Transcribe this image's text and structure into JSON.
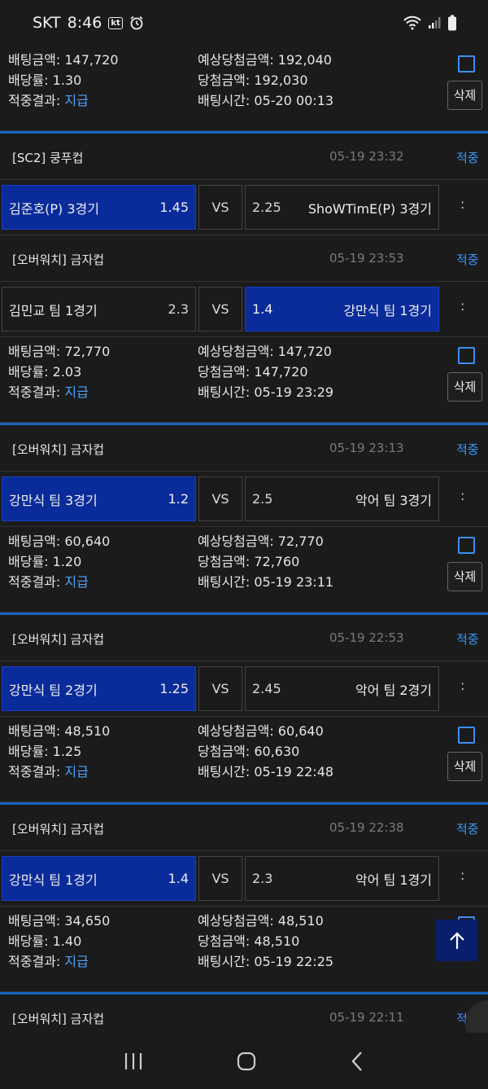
{
  "status_bar": {
    "carrier": "SKT",
    "time": "8:46",
    "kt_badge": "kt"
  },
  "labels": {
    "bet_amount": "배팅금액: ",
    "odds": "배당률: ",
    "result": "적중결과: ",
    "expected_win": "예상당첨금액: ",
    "win_amount": "당첨금액: ",
    "bet_time": "배팅시간: ",
    "delete": "삭제",
    "vs": "VS",
    "more": ":"
  },
  "top_bet": {
    "bet_amount": "147,720",
    "odds": "1.30",
    "result": "지급",
    "expected_win": "192,040",
    "win_amount": "192,030",
    "bet_time": "05-20 00:13"
  },
  "entries": [
    {
      "title": "[SC2] 쿵푸컵",
      "time": "05-19 23:32",
      "status": "적중",
      "home": "김준호(P) 3경기",
      "home_odd": "1.45",
      "away_odd": "2.25",
      "away": "ShoWTimE(P) 3경기",
      "bet_amount": "72,770",
      "odds": "2.03",
      "result": "지급",
      "expected_win": "147,720",
      "win_amount": "147,720",
      "bet_time": "05-19 23:29"
    },
    {
      "title": "[오버워치] 금자컵",
      "time": "05-19 23:53",
      "status": "적중",
      "home": "김민교 팀 1경기",
      "home_odd": "2.3",
      "away_odd": "1.4",
      "away": "강만식 팀 1경기"
    },
    {
      "title": "[오버워치] 금자컵",
      "time": "05-19 23:13",
      "status": "적중",
      "home": "강만식 팀 3경기",
      "home_odd": "1.2",
      "away_odd": "2.5",
      "away": "악어 팀 3경기",
      "bet_amount": "60,640",
      "odds": "1.20",
      "result": "지급",
      "expected_win": "72,770",
      "win_amount": "72,760",
      "bet_time": "05-19 23:11"
    },
    {
      "title": "[오버워치] 금자컵",
      "time": "05-19 22:53",
      "status": "적중",
      "home": "강만식 팀 2경기",
      "home_odd": "1.25",
      "away_odd": "2.45",
      "away": "악어 팀 2경기",
      "bet_amount": "48,510",
      "odds": "1.25",
      "result": "지급",
      "expected_win": "60,640",
      "win_amount": "60,630",
      "bet_time": "05-19 22:48"
    },
    {
      "title": "[오버워치] 금자컵",
      "time": "05-19 22:38",
      "status": "적중",
      "home": "강만식 팀 1경기",
      "home_odd": "1.4",
      "away_odd": "2.3",
      "away": "악어 팀 1경기",
      "bet_amount": "34,650",
      "odds": "1.40",
      "result": "지급",
      "expected_win": "48,510",
      "win_amount": "48,510",
      "bet_time": "05-19 22:25"
    },
    {
      "title": "[오버워치] 금자컵",
      "time": "05-19 22:11",
      "status": "적중"
    }
  ],
  "colors": {
    "selected": "#0a2b9a",
    "accent": "#3a97ff",
    "divider": "#1565c0"
  }
}
